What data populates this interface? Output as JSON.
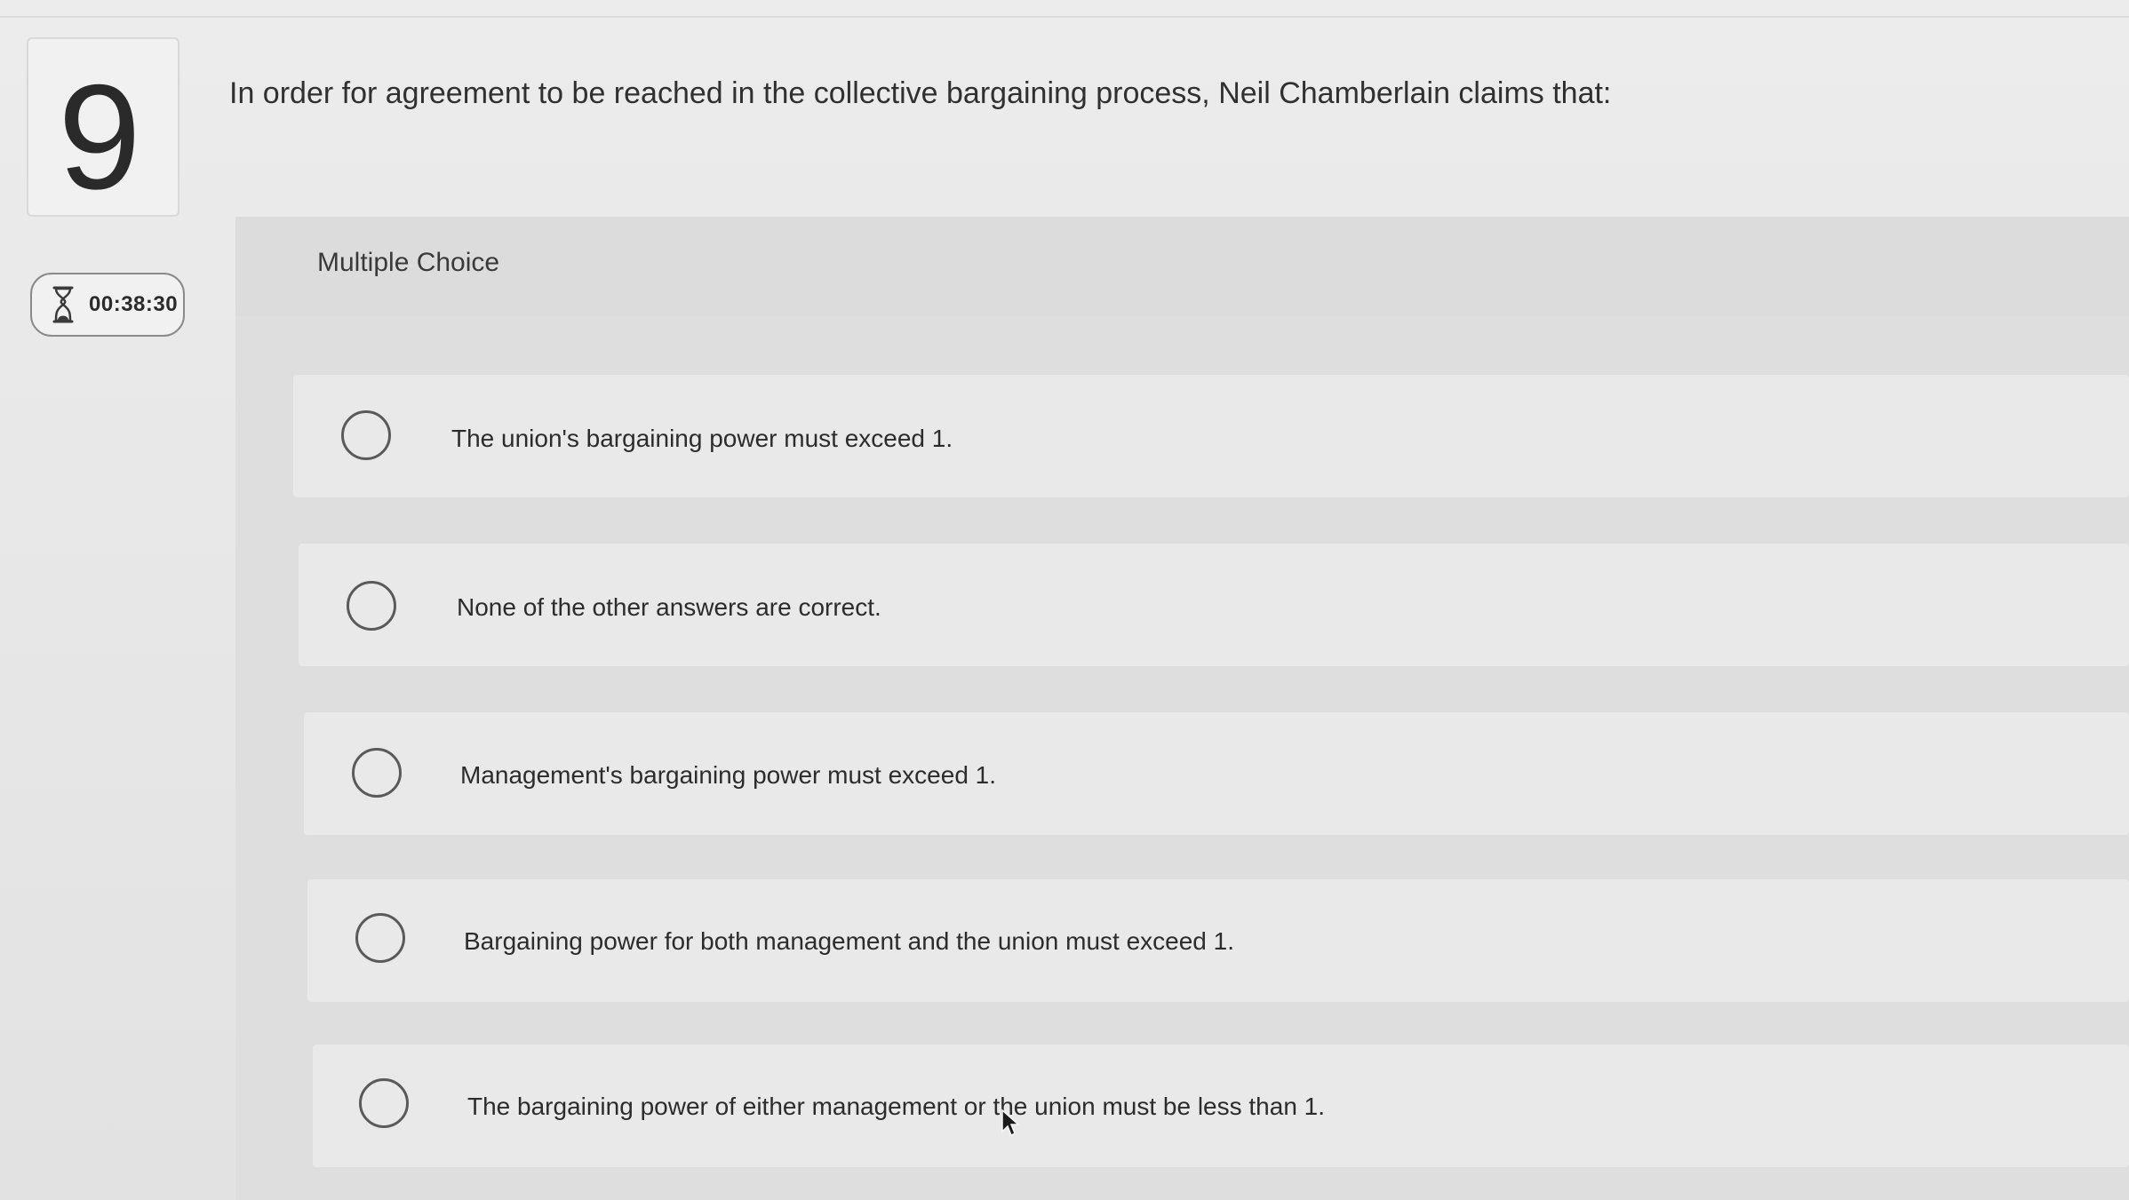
{
  "question": {
    "number": "9",
    "text": "In order for agreement to be reached in the collective bargaining process, Neil Chamberlain claims that:"
  },
  "timer": {
    "icon": "hourglass-icon",
    "value": "00:38:30"
  },
  "answer_section": {
    "label": "Multiple Choice",
    "options": [
      {
        "label": "The union's bargaining power must exceed 1."
      },
      {
        "label": "None of the other answers are correct."
      },
      {
        "label": "Management's bargaining power must exceed 1."
      },
      {
        "label": "Bargaining power for both management and the union must exceed 1."
      },
      {
        "label": "The bargaining power of either management or the union must be less than 1."
      }
    ]
  },
  "colors": {
    "background": "#e8e8e8",
    "panel": "#dedede",
    "option_row": "#e9e9e9",
    "radio_border": "#5a5a5a",
    "text": "#2b2b2b"
  }
}
